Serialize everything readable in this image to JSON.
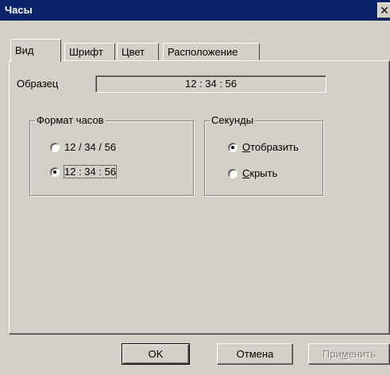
{
  "window": {
    "title": "Часы",
    "close_symbol": "✕"
  },
  "tabs": [
    {
      "label": "Вид",
      "active": true
    },
    {
      "label": "Шрифт",
      "active": false
    },
    {
      "label": "Цвет",
      "active": false
    },
    {
      "label": "Расположение",
      "active": false
    }
  ],
  "sample": {
    "label": "Образец",
    "value": "12 : 34 : 56"
  },
  "clock_format": {
    "title": "Формат часов",
    "options": [
      {
        "label": "12 / 34 / 56",
        "selected": false
      },
      {
        "label": "12 : 34 : 56",
        "selected": true
      }
    ]
  },
  "seconds": {
    "title": "Секунды",
    "show_first": "О",
    "show_rest": "тобразить",
    "show_selected": true,
    "hide_first": "С",
    "hide_rest": "крыть",
    "hide_selected": false
  },
  "buttons": {
    "ok": "OK",
    "cancel": "Отмена",
    "apply_pre": "При",
    "apply_u": "м",
    "apply_post": "енить"
  }
}
